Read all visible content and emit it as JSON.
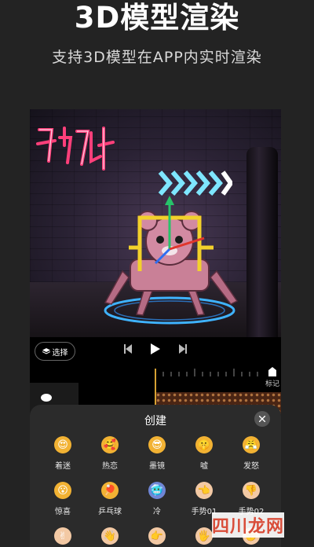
{
  "header": {
    "title": "3D模型渲染",
    "subtitle": "支持3D模型在APP内实时渲染"
  },
  "editor": {
    "select_label": "选择",
    "marker_label": "标记"
  },
  "sheet": {
    "title": "创建",
    "items": [
      {
        "label": "着迷",
        "icon": "heart-eyes-emoji",
        "color": "#f2b233"
      },
      {
        "label": "热恋",
        "icon": "love-face-emoji",
        "color": "#f2b233"
      },
      {
        "label": "墨镜",
        "icon": "sunglasses-emoji",
        "color": "#f2b233"
      },
      {
        "label": "嘘",
        "icon": "shush-emoji",
        "color": "#f2b233"
      },
      {
        "label": "发怒",
        "icon": "angry-emoji",
        "color": "#f2b233"
      },
      {
        "label": "惊喜",
        "icon": "surprise-emoji",
        "color": "#f2b233"
      },
      {
        "label": "乒乓球",
        "icon": "ping-pong-emoji",
        "color": "#f2b233"
      },
      {
        "label": "冷",
        "icon": "cold-emoji",
        "color": "#6f86d6"
      },
      {
        "label": "手势01",
        "icon": "hand-gesture-emoji",
        "color": "#f3c9a4"
      },
      {
        "label": "手势02",
        "icon": "thumbs-down-emoji",
        "color": "#f3c9a4"
      }
    ],
    "partial_row": [
      "peace-hand-emoji",
      "wave-hand-emoji",
      "point-hand-emoji",
      "open-hand-emoji",
      "fist-hand-emoji"
    ]
  },
  "watermark": "四川龙网"
}
